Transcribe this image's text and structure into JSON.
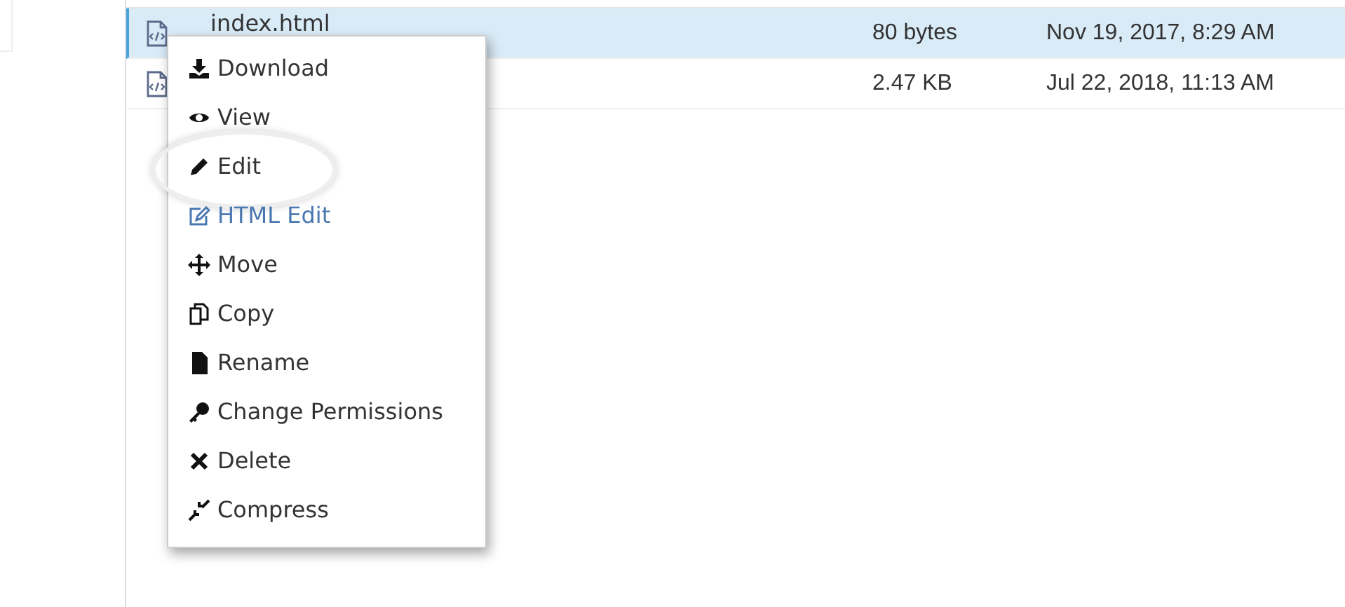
{
  "files": [
    {
      "name": "index.html",
      "size": "80 bytes",
      "modified": "Nov 19, 2017, 8:29 AM",
      "selected": true
    },
    {
      "size": "2.47 KB",
      "modified": "Jul 22, 2018, 11:13 AM",
      "selected": false
    }
  ],
  "context_menu": {
    "items": [
      {
        "label": "Download",
        "kind": "download",
        "circled": false
      },
      {
        "label": "View",
        "kind": "view",
        "circled": false
      },
      {
        "label": "Edit",
        "kind": "edit",
        "circled": true
      },
      {
        "label": "HTML Edit",
        "kind": "htmledit",
        "circled": false
      },
      {
        "label": "Move",
        "kind": "move",
        "circled": false
      },
      {
        "label": "Copy",
        "kind": "copy",
        "circled": false
      },
      {
        "label": "Rename",
        "kind": "rename",
        "circled": false
      },
      {
        "label": "Change Permissions",
        "kind": "key",
        "circled": false
      },
      {
        "label": "Delete",
        "kind": "delete",
        "circled": false
      },
      {
        "label": "Compress",
        "kind": "compress",
        "circled": false
      }
    ]
  }
}
